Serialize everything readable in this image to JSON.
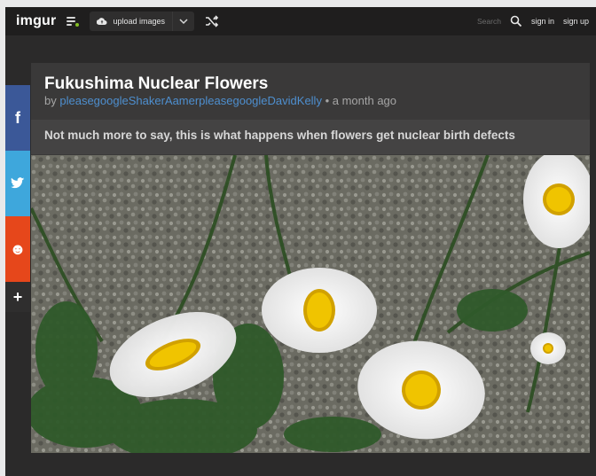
{
  "topbar": {
    "logo": "imgur",
    "upload_label": "upload images",
    "search_placeholder": "Search",
    "sign_in": "sign in",
    "sign_up": "sign up"
  },
  "post": {
    "title": "Fukushima Nuclear Flowers",
    "by_prefix": "by",
    "author": "pleasegoogleShakerAamerpleasegoogleDavidKelly",
    "time_suffix": "• a month ago",
    "description": "Not much more to say, this is what happens when flowers get nuclear birth defects"
  },
  "share": {
    "facebook": "f",
    "reddit_glyph": "☻",
    "plus": "+"
  },
  "colors": {
    "topbar": "#1f1e1e",
    "panel": "#3a3939",
    "accent_link": "#4e8fcf",
    "facebook": "#3b5898",
    "twitter": "#3ea7dc",
    "reddit": "#e6471b"
  },
  "icons": [
    "menu-icon",
    "cloud-upload-icon",
    "chevron-down-icon",
    "shuffle-icon",
    "search-icon",
    "facebook-icon",
    "twitter-icon",
    "reddit-icon",
    "plus-icon"
  ]
}
